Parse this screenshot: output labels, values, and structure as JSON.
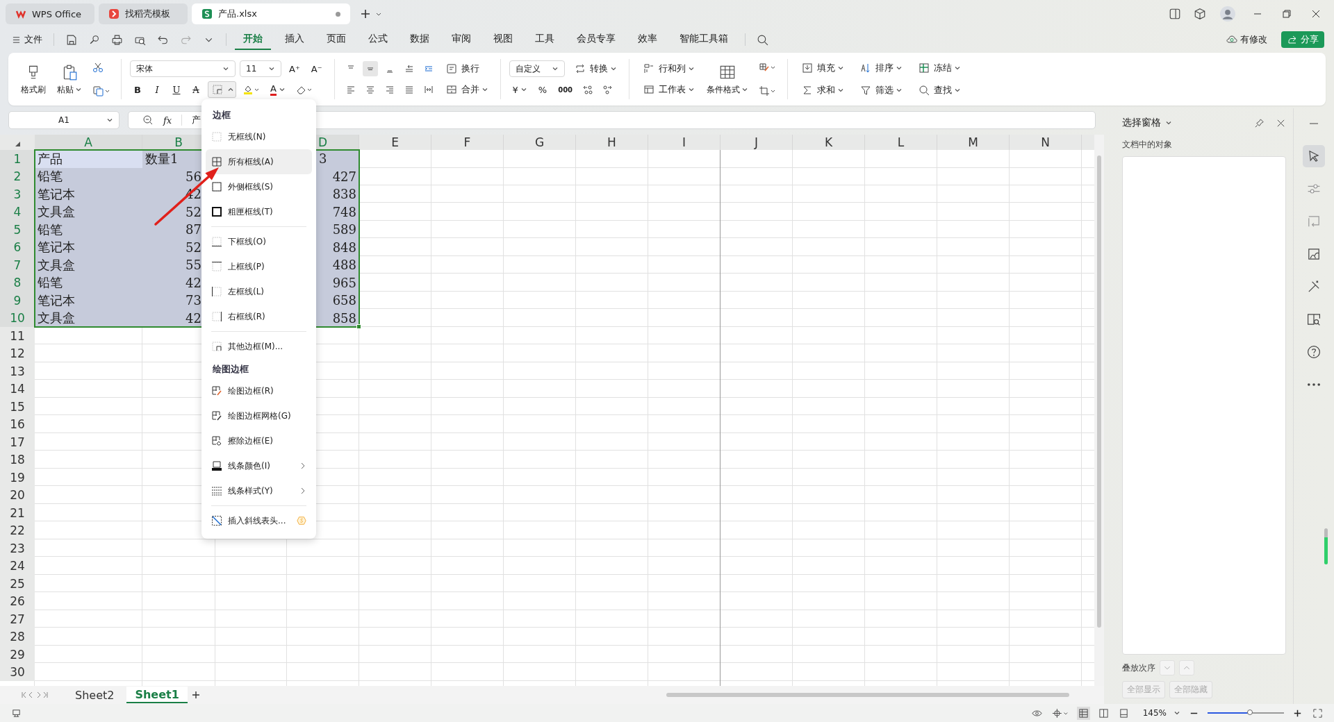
{
  "tabs": [
    {
      "label": "WPS Office",
      "kind": "wps",
      "selected": false
    },
    {
      "label": "找稻壳模板",
      "kind": "docer",
      "selected": false
    },
    {
      "label": "产品.xlsx",
      "kind": "sheet",
      "selected": true,
      "modified": true
    }
  ],
  "menu": {
    "file": "文件",
    "tabs": [
      {
        "label": "开始",
        "selected": true
      },
      {
        "label": "插入",
        "selected": false
      },
      {
        "label": "页面",
        "selected": false
      },
      {
        "label": "公式",
        "selected": false
      },
      {
        "label": "数据",
        "selected": false
      },
      {
        "label": "审阅",
        "selected": false
      },
      {
        "label": "视图",
        "selected": false
      },
      {
        "label": "工具",
        "selected": false
      },
      {
        "label": "会员专享",
        "selected": false
      },
      {
        "label": "效率",
        "selected": false
      },
      {
        "label": "智能工具箱",
        "selected": false
      }
    ],
    "changes": "有修改",
    "share": "分享"
  },
  "ribbon": {
    "format_painter": "格式刷",
    "paste": "粘贴",
    "font": "宋体",
    "size": "11",
    "grow": "A⁺",
    "shrink": "A⁻",
    "styles": [
      "B",
      "I",
      "U",
      "A"
    ],
    "font_color": "A",
    "border_open": true,
    "wrap": "换行",
    "merge": "合并",
    "number_format": "自定义",
    "convert": "转换",
    "currency": "¥",
    "percent": "%",
    "thousands": "000",
    "rows_cols": "行和列",
    "worksheet": "工作表",
    "conditional": "条件格式",
    "fill": "填充",
    "sort": "排序",
    "freeze": "冻结",
    "sum": "求和",
    "filter": "筛选",
    "find": "查找"
  },
  "formula_bar": {
    "cell": "A1",
    "fx": "fx",
    "content": "产"
  },
  "columns": [
    "A",
    "B",
    "D",
    "E",
    "F",
    "G",
    "H",
    "I",
    "J",
    "K",
    "L",
    "M",
    "N"
  ],
  "row_numbers": [
    "1",
    "2",
    "3",
    "4",
    "5",
    "6",
    "7",
    "8",
    "9",
    "10",
    "11",
    "12",
    "13",
    "14",
    "15",
    "16",
    "17",
    "18",
    "19",
    "20",
    "21",
    "22",
    "23",
    "24",
    "25",
    "26",
    "27",
    "28",
    "29",
    "30"
  ],
  "rows": [
    {
      "a": "产品",
      "b": "数量1",
      "d": "3",
      "selected": true,
      "active": true
    },
    {
      "a": "铅笔",
      "b": "56",
      "d": "427",
      "selected": true,
      "active": false
    },
    {
      "a": "笔记本",
      "b": "42",
      "d": "838",
      "selected": true,
      "active": false
    },
    {
      "a": "文具盒",
      "b": "52",
      "d": "748",
      "selected": true,
      "active": false
    },
    {
      "a": "铅笔",
      "b": "87",
      "d": "589",
      "selected": true,
      "active": false
    },
    {
      "a": "笔记本",
      "b": "52",
      "d": "848",
      "selected": true,
      "active": false
    },
    {
      "a": "文具盒",
      "b": "55",
      "d": "488",
      "selected": true,
      "active": false
    },
    {
      "a": "铅笔",
      "b": "42",
      "d": "965",
      "selected": true,
      "active": false
    },
    {
      "a": "笔记本",
      "b": "73",
      "d": "658",
      "selected": true,
      "active": false
    },
    {
      "a": "文具盒",
      "b": "42",
      "d": "858",
      "selected": true,
      "active": false
    }
  ],
  "border_menu": {
    "sections": [
      {
        "title": "边框",
        "groups": [
          [
            {
              "label": "无框线(N)",
              "kind": "none",
              "selected": false
            },
            {
              "label": "所有框线(A)",
              "kind": "all",
              "selected": true
            },
            {
              "label": "外侧框线(S)",
              "kind": "outside",
              "selected": false
            },
            {
              "label": "粗匣框线(T)",
              "kind": "thick",
              "selected": false
            }
          ],
          [
            {
              "label": "下框线(O)",
              "kind": "bottom",
              "selected": false
            },
            {
              "label": "上框线(P)",
              "kind": "top",
              "selected": false
            },
            {
              "label": "左框线(L)",
              "kind": "left",
              "selected": false
            },
            {
              "label": "右框线(R)",
              "kind": "right",
              "selected": false
            }
          ],
          [
            {
              "label": "其他边框(M)...",
              "kind": "more",
              "selected": false
            }
          ]
        ]
      },
      {
        "title": "绘图边框",
        "groups": [
          [
            {
              "label": "绘图边框(R)",
              "kind": "draw",
              "selected": false
            },
            {
              "label": "绘图边框网格(G)",
              "kind": "draw_grid",
              "selected": false
            },
            {
              "label": "擦除边框(E)",
              "kind": "erase",
              "selected": false
            },
            {
              "label": "线条颜色(I)",
              "kind": "line_color",
              "selected": false,
              "submenu": true
            },
            {
              "label": "线条样式(Y)",
              "kind": "line_style",
              "selected": false,
              "submenu": true
            }
          ],
          [
            {
              "label": "插入斜线表头...",
              "kind": "diagonal",
              "selected": false,
              "premium": true
            }
          ]
        ]
      }
    ]
  },
  "sheets": [
    {
      "label": "Sheet2",
      "selected": false
    },
    {
      "label": "Sheet1",
      "selected": true
    }
  ],
  "pane": {
    "title": "选择窗格",
    "subtitle": "文档中的对象",
    "order": "叠放次序",
    "buttons": [
      {
        "label": "全部显示",
        "disabled": true
      },
      {
        "label": "全部隐藏",
        "disabled": true
      }
    ]
  },
  "status": {
    "zoom": "145%",
    "level": 0.55
  }
}
